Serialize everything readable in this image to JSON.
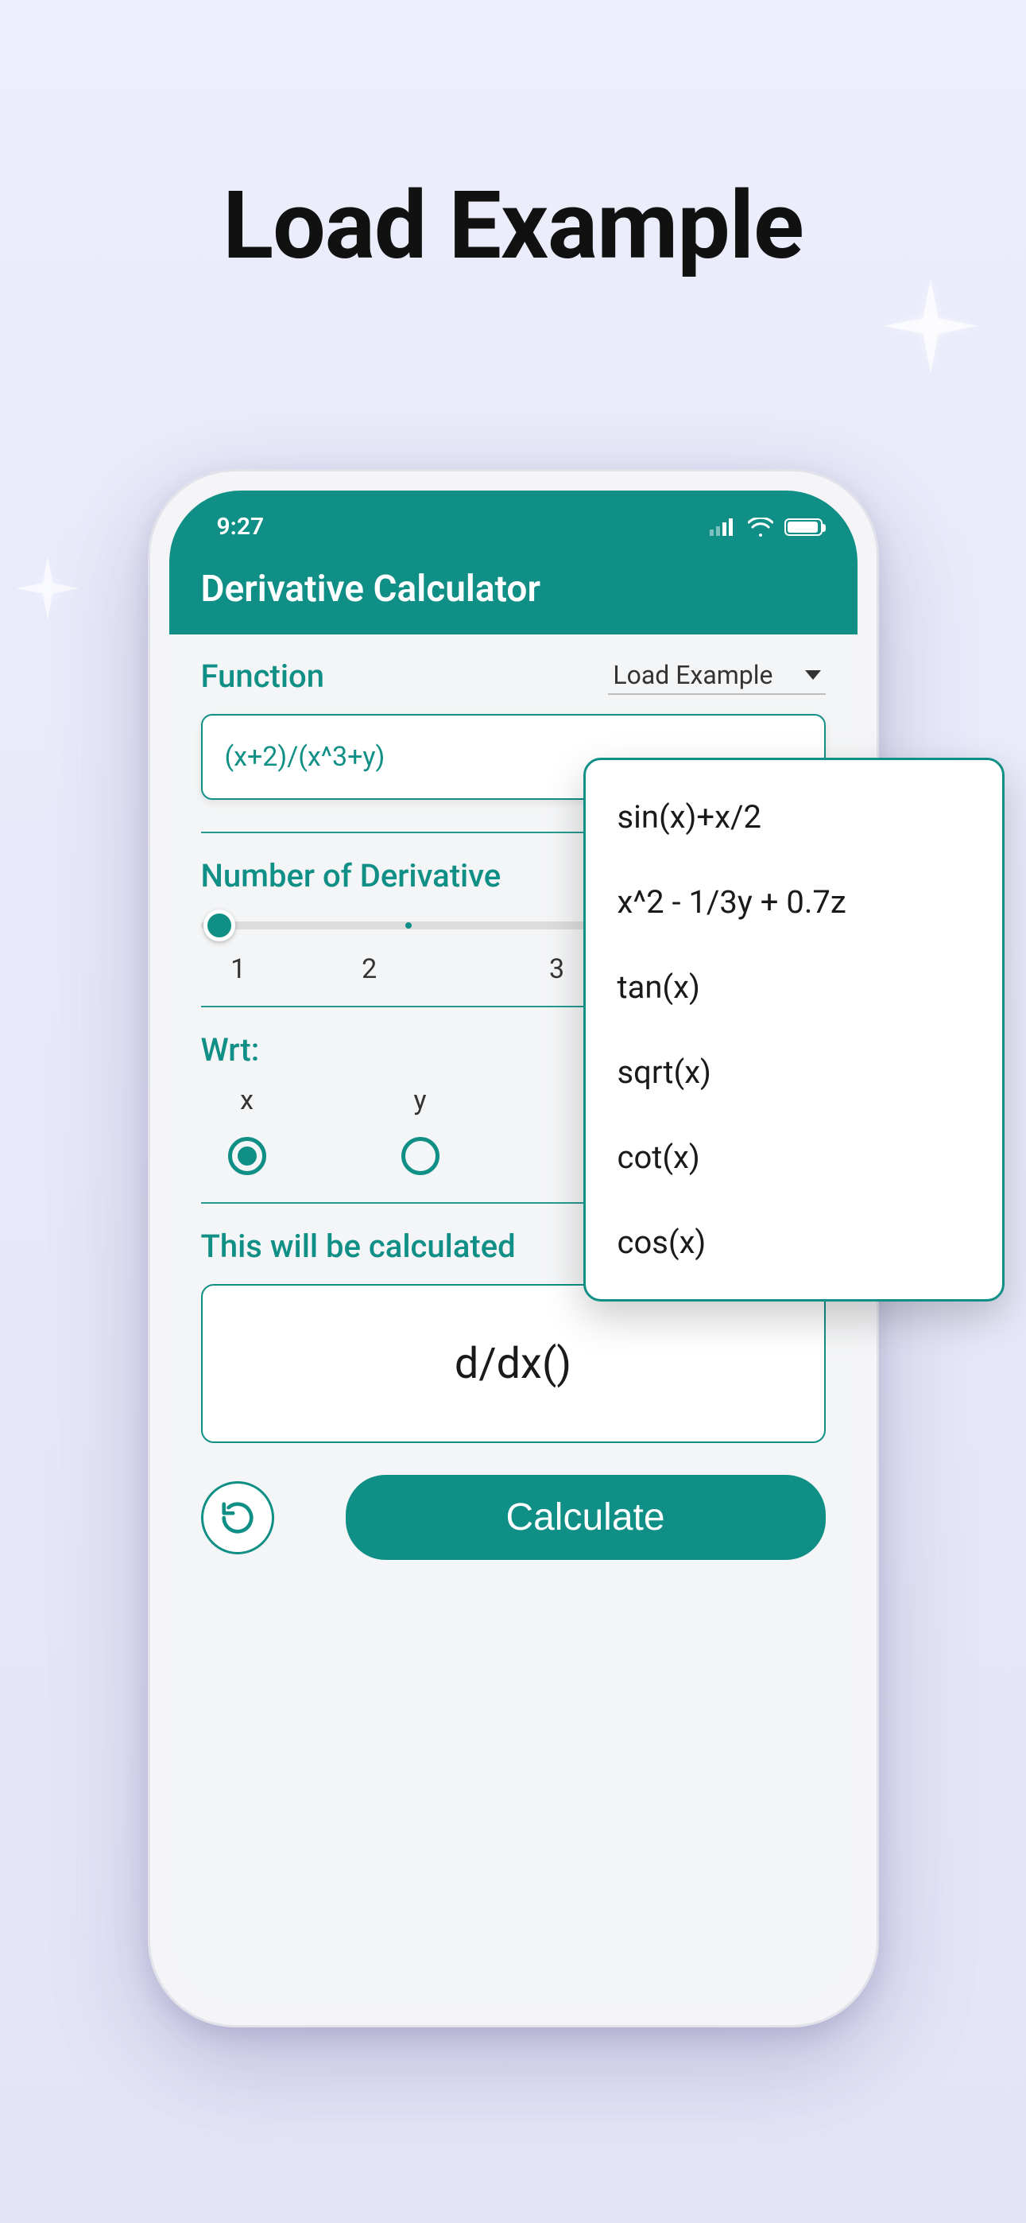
{
  "page_title": "Load Example",
  "status": {
    "time": "9:27"
  },
  "app_title": "Derivative Calculator",
  "function": {
    "label": "Function",
    "value": "(x+2)/(x^3+y)"
  },
  "dropdown": {
    "label": "Load Example",
    "options": [
      "sin(x)+x/2",
      "x^2 - 1/3y + 0.7z",
      "tan(x)",
      "sqrt(x)",
      "cot(x)",
      "cos(x)"
    ]
  },
  "num_derivative": {
    "label": "Number of Derivative",
    "ticks": [
      "1",
      "2",
      "3"
    ],
    "selected": "1"
  },
  "wrt": {
    "label": "Wrt:",
    "options": [
      "x",
      "y"
    ],
    "selected": "x"
  },
  "calc_preview": {
    "label": "This will be calculated",
    "value": "d/dx()"
  },
  "calculate_button": "Calculate"
}
